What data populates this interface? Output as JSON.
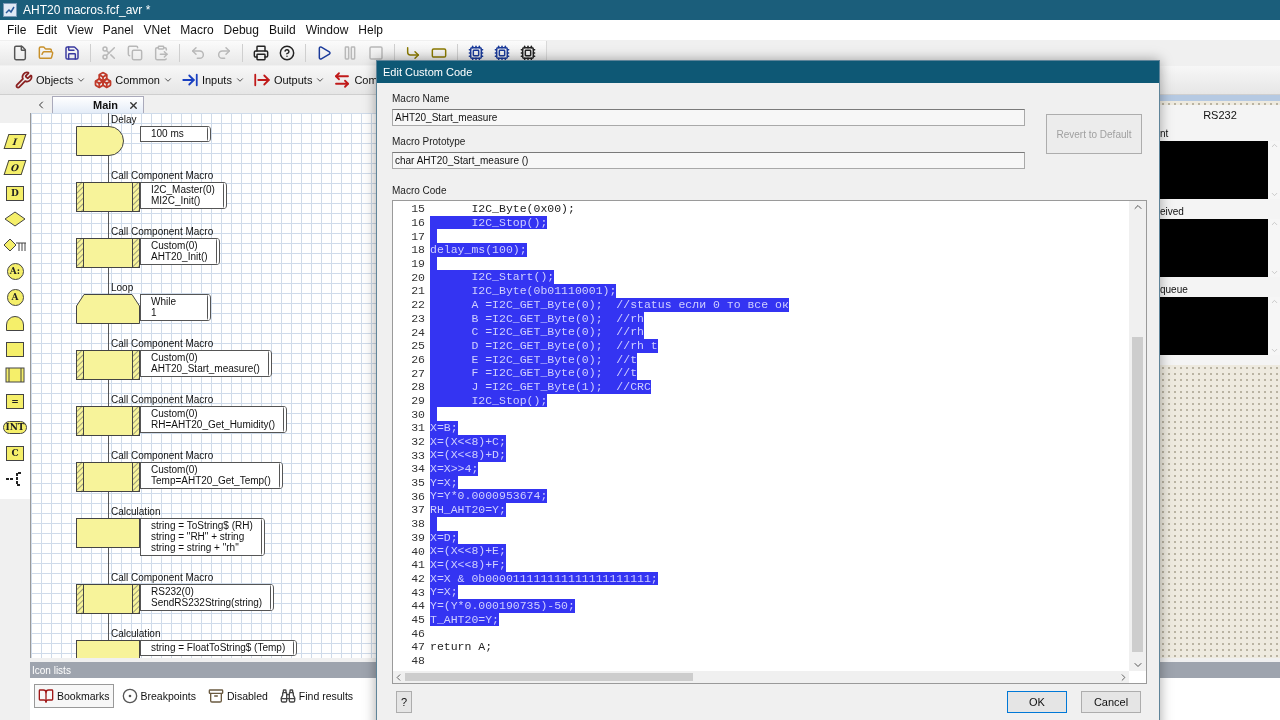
{
  "window": {
    "title": "AHT20 macros.fcf_avr *"
  },
  "menu": [
    "File",
    "Edit",
    "View",
    "Panel",
    "VNet",
    "Macro",
    "Debug",
    "Build",
    "Window",
    "Help"
  ],
  "toolbar": [
    {
      "disabled": false
    },
    {
      "disabled": false
    },
    {
      "disabled": false
    },
    {
      "disabled": true
    },
    {
      "disabled": true
    },
    {
      "disabled": true
    },
    {
      "disabled": true
    },
    {
      "disabled": true
    },
    {
      "disabled": false
    },
    {
      "disabled": false
    },
    {
      "disabled": false
    },
    {
      "disabled": true
    },
    {
      "disabled": true
    },
    {
      "disabled": false
    },
    {
      "disabled": false
    },
    {
      "disabled": false
    },
    {
      "disabled": false
    },
    {
      "disabled": false
    }
  ],
  "component_toolbar": [
    {
      "label": "Objects"
    },
    {
      "label": "Common"
    },
    {
      "label": "Inputs"
    },
    {
      "label": "Outputs"
    },
    {
      "label": "Com"
    }
  ],
  "tabs": [
    {
      "label": "Main",
      "selected": true
    }
  ],
  "palette": [
    {
      "kind": "para",
      "glyph": "I"
    },
    {
      "kind": "para",
      "glyph": "O"
    },
    {
      "kind": "rect",
      "glyph": "D"
    },
    {
      "kind": "diamond"
    },
    {
      "kind": "switch"
    },
    {
      "kind": "circle",
      "glyph": "A:"
    },
    {
      "kind": "circle",
      "glyph": "A"
    },
    {
      "kind": "dome"
    },
    {
      "kind": "rect"
    },
    {
      "kind": "hatch"
    },
    {
      "kind": "rect",
      "glyph": "="
    },
    {
      "kind": "oval",
      "glyph": "INT"
    },
    {
      "kind": "rect",
      "glyph": "C"
    },
    {
      "kind": "comment"
    }
  ],
  "flowchart": [
    {
      "kind": "delay",
      "label": "Delay",
      "comment": [
        "100 ms"
      ]
    },
    {
      "kind": "call",
      "label": "Call Component Macro",
      "comment": [
        "I2C_Master(0)",
        "MI2C_Init()"
      ]
    },
    {
      "kind": "call",
      "label": "Call Component Macro",
      "comment": [
        "Custom(0)",
        "AHT20_Init()"
      ]
    },
    {
      "kind": "loop",
      "label": "Loop",
      "comment": [
        "While",
        "1"
      ]
    },
    {
      "kind": "call",
      "label": "Call Component Macro",
      "comment": [
        "Custom(0)",
        "AHT20_Start_measure()"
      ]
    },
    {
      "kind": "call",
      "label": "Call Component Macro",
      "comment": [
        "Custom(0)",
        "RH=AHT20_Get_Humidity()"
      ]
    },
    {
      "kind": "call",
      "label": "Call Component Macro",
      "comment": [
        "Custom(0)",
        "Temp=AHT20_Get_Temp()"
      ]
    },
    {
      "kind": "calculation",
      "label": "Calculation",
      "comment": [
        "string = ToString$ (RH)",
        "string = \"RH\" + string",
        "string = string + \"rh\""
      ]
    },
    {
      "kind": "call",
      "label": "Call Component Macro",
      "comment": [
        "RS232(0)",
        "SendRS232String(string)"
      ]
    },
    {
      "kind": "calculation",
      "label": "Calculation",
      "comment": [
        "string = FloatToString$ (Temp)"
      ]
    }
  ],
  "right_panel": {
    "title": "RS232",
    "sections": [
      "nt",
      "eived",
      "queue"
    ]
  },
  "icon_lists": {
    "title": "Icon lists",
    "tabs": [
      {
        "label": "Bookmarks",
        "selected": true
      },
      {
        "label": "Breakpoints",
        "selected": false
      },
      {
        "label": "Disabled",
        "selected": false
      },
      {
        "label": "Find results",
        "selected": false
      }
    ]
  },
  "dialog": {
    "title": "Edit Custom Code",
    "name_label": "Macro Name",
    "name_value": "AHT20_Start_measure",
    "prototype_label": "Macro Prototype",
    "prototype_value": "char AHT20_Start_measure ()",
    "revert_button": {
      "label": "Revert to Default",
      "disabled": true
    },
    "code_label": "Macro Code",
    "code_lines": [
      {
        "n": "15",
        "text": "      I2C_Byte(0x00);",
        "selected": false
      },
      {
        "n": "16",
        "text": "      I2C_Stop();",
        "selected": true
      },
      {
        "n": "17",
        "selected": true
      },
      {
        "n": "18",
        "text": "delay_ms(100);",
        "selected": true
      },
      {
        "n": "19",
        "selected": true
      },
      {
        "n": "20",
        "text": "      I2C_Start();",
        "selected": true
      },
      {
        "n": "21",
        "text": "      I2C_Byte(0b01110001);",
        "selected": true
      },
      {
        "n": "22",
        "text": "      A =I2C_GET_Byte(0);  //status если 0 то все ок",
        "selected": true
      },
      {
        "n": "23",
        "text": "      B =I2C_GET_Byte(0);  //rh",
        "selected": true
      },
      {
        "n": "24",
        "text": "      C =I2C_GET_Byte(0);  //rh",
        "selected": true
      },
      {
        "n": "25",
        "text": "      D =I2C_GET_Byte(0);  //rh t",
        "selected": true
      },
      {
        "n": "26",
        "text": "      E =I2C_GET_Byte(0);  //t",
        "selected": true
      },
      {
        "n": "27",
        "text": "      F =I2C_GET_Byte(0);  //t",
        "selected": true
      },
      {
        "n": "28",
        "text": "      J =I2C_GET_Byte(1);  //CRC",
        "selected": true
      },
      {
        "n": "29",
        "text": "      I2C_Stop();",
        "selected": true
      },
      {
        "n": "30",
        "selected": true
      },
      {
        "n": "31",
        "text": "X=B;",
        "selected": true
      },
      {
        "n": "32",
        "text": "X=(X<<8)+C;",
        "selected": true
      },
      {
        "n": "33",
        "text": "X=(X<<8)+D;",
        "selected": true
      },
      {
        "n": "34",
        "text": "X=X>>4;",
        "selected": true
      },
      {
        "n": "35",
        "text": "Y=X;",
        "selected": true
      },
      {
        "n": "36",
        "text": "Y=Y*0.0000953674;",
        "selected": true
      },
      {
        "n": "37",
        "text": "RH_AHT20=Y;",
        "selected": true
      },
      {
        "n": "38",
        "selected": true
      },
      {
        "n": "39",
        "text": "X=D;",
        "selected": true
      },
      {
        "n": "40",
        "text": "X=(X<<8)+E;",
        "selected": true
      },
      {
        "n": "41",
        "text": "X=(X<<8)+F;",
        "selected": true
      },
      {
        "n": "42",
        "text": "X=X & 0b000011111111111111111111;",
        "selected": true
      },
      {
        "n": "43",
        "text": "Y=X;",
        "selected": true
      },
      {
        "n": "44",
        "text": "Y=(Y*0.000190735)-50;",
        "selected": true
      },
      {
        "n": "45",
        "text": "T_AHT20=Y;",
        "selected": true
      },
      {
        "n": "46",
        "selected": false
      },
      {
        "n": "47",
        "text": "return A;",
        "selected": false
      },
      {
        "n": "48",
        "selected": false
      }
    ],
    "buttons": [
      {
        "kind": "help",
        "label": "?"
      },
      {
        "kind": "ok",
        "label": "OK"
      },
      {
        "kind": "cancel",
        "label": "Cancel"
      }
    ]
  }
}
